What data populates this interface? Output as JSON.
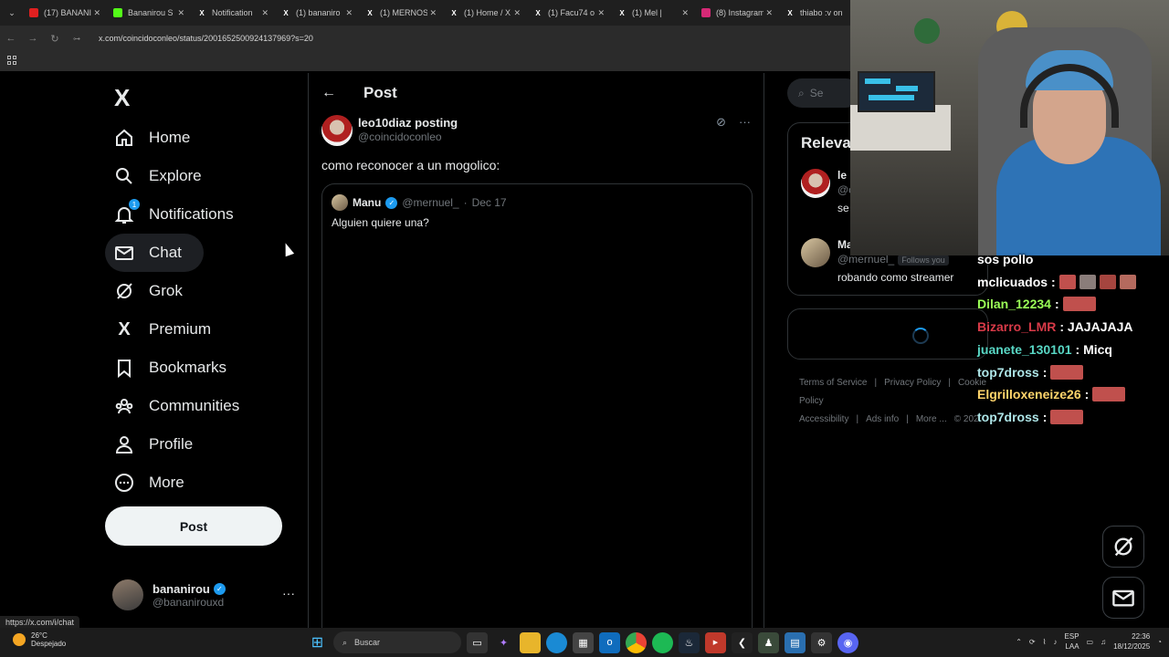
{
  "browser": {
    "tabs": [
      {
        "label": "(17) BANANI",
        "color": "#e02020"
      },
      {
        "label": "Bananirou S",
        "color": "#53fc18"
      },
      {
        "label": "Notification",
        "color": "#ffffff"
      },
      {
        "label": "(1) bananiro",
        "color": "#ffffff"
      },
      {
        "label": "(1) MERNOS",
        "color": "#ffffff"
      },
      {
        "label": "(1) Home / X",
        "color": "#ffffff"
      },
      {
        "label": "(1) Facu74 o",
        "color": "#ffffff"
      },
      {
        "label": "(1) Mel |",
        "color": "#ffffff"
      },
      {
        "label": "(8) Instagram",
        "color": "#d62976"
      },
      {
        "label": "thiabo :v on",
        "color": "#ffffff"
      }
    ],
    "url": "x.com/coincidoconleo/status/2001652500924137969?s=20",
    "status_link": "https://x.com/i/chat"
  },
  "sidebar": {
    "logo": "X",
    "items": [
      {
        "label": "Home",
        "icon": "home-icon"
      },
      {
        "label": "Explore",
        "icon": "search-icon"
      },
      {
        "label": "Notifications",
        "icon": "bell-icon",
        "badge": "1"
      },
      {
        "label": "Chat",
        "icon": "mail-icon"
      },
      {
        "label": "Grok",
        "icon": "grok-icon"
      },
      {
        "label": "Premium",
        "icon": "x-premium-icon"
      },
      {
        "label": "Bookmarks",
        "icon": "bookmark-icon"
      },
      {
        "label": "Communities",
        "icon": "communities-icon"
      },
      {
        "label": "Profile",
        "icon": "profile-icon"
      },
      {
        "label": "More",
        "icon": "more-circle-icon"
      }
    ],
    "post_label": "Post",
    "account": {
      "name": "bananirou",
      "handle": "@bananirouxd"
    }
  },
  "main": {
    "title": "Post",
    "tweet": {
      "name": "leo10diaz posting",
      "handle": "@coincidoconleo",
      "text": "como reconocer a un mogolico:"
    },
    "quote": {
      "name": "Manu",
      "handle": "@mernuel_",
      "sep": "·",
      "date": "Dec 17",
      "text": "Alguien quiere una?"
    }
  },
  "right": {
    "search_placeholder": "Se",
    "relevant_title": "Releva",
    "people": [
      {
        "name": "le",
        "handle": "@c",
        "bio": "se"
      },
      {
        "name": "Ma",
        "handle": "@mernuel_",
        "follows": "Follows you",
        "bio": "robando como streamer"
      }
    ],
    "footer": [
      "Terms of Service",
      "|",
      "Privacy Policy",
      "|",
      "Cookie Policy",
      "Accessibility",
      "|",
      "Ads info",
      "|",
      "More ...",
      "© 202"
    ]
  },
  "stream_chat": [
    {
      "user": "sos pollo",
      "color": "#ffffff",
      "msg": ""
    },
    {
      "user": "mclicuados",
      "color": "#ffffff",
      "msg": ":",
      "emotes": 4
    },
    {
      "user": "Dilan_12234",
      "color": "#9bff57",
      "msg": ":",
      "emotes": 1
    },
    {
      "user": "Bizarro_LMR",
      "color": "#d83a48",
      "msg": ": JAJAJAJA"
    },
    {
      "user": "juanete_130101",
      "color": "#58d6c4",
      "msg": ": Micq"
    },
    {
      "user": "top7dross",
      "color": "#aee6e8",
      "msg": ":",
      "emotes": 1
    },
    {
      "user": "Elgrilloxeneize26",
      "color": "#ffd46b",
      "msg": ":",
      "emotes": 1
    },
    {
      "user": "top7dross",
      "color": "#aee6e8",
      "msg": ":",
      "emotes": 1
    }
  ],
  "taskbar": {
    "temp": "26°C",
    "weather": "Despejado",
    "search": "Buscar",
    "lang": "ESP",
    "lang2": "LAA",
    "time": "22:36",
    "date": "18/12/2025"
  }
}
